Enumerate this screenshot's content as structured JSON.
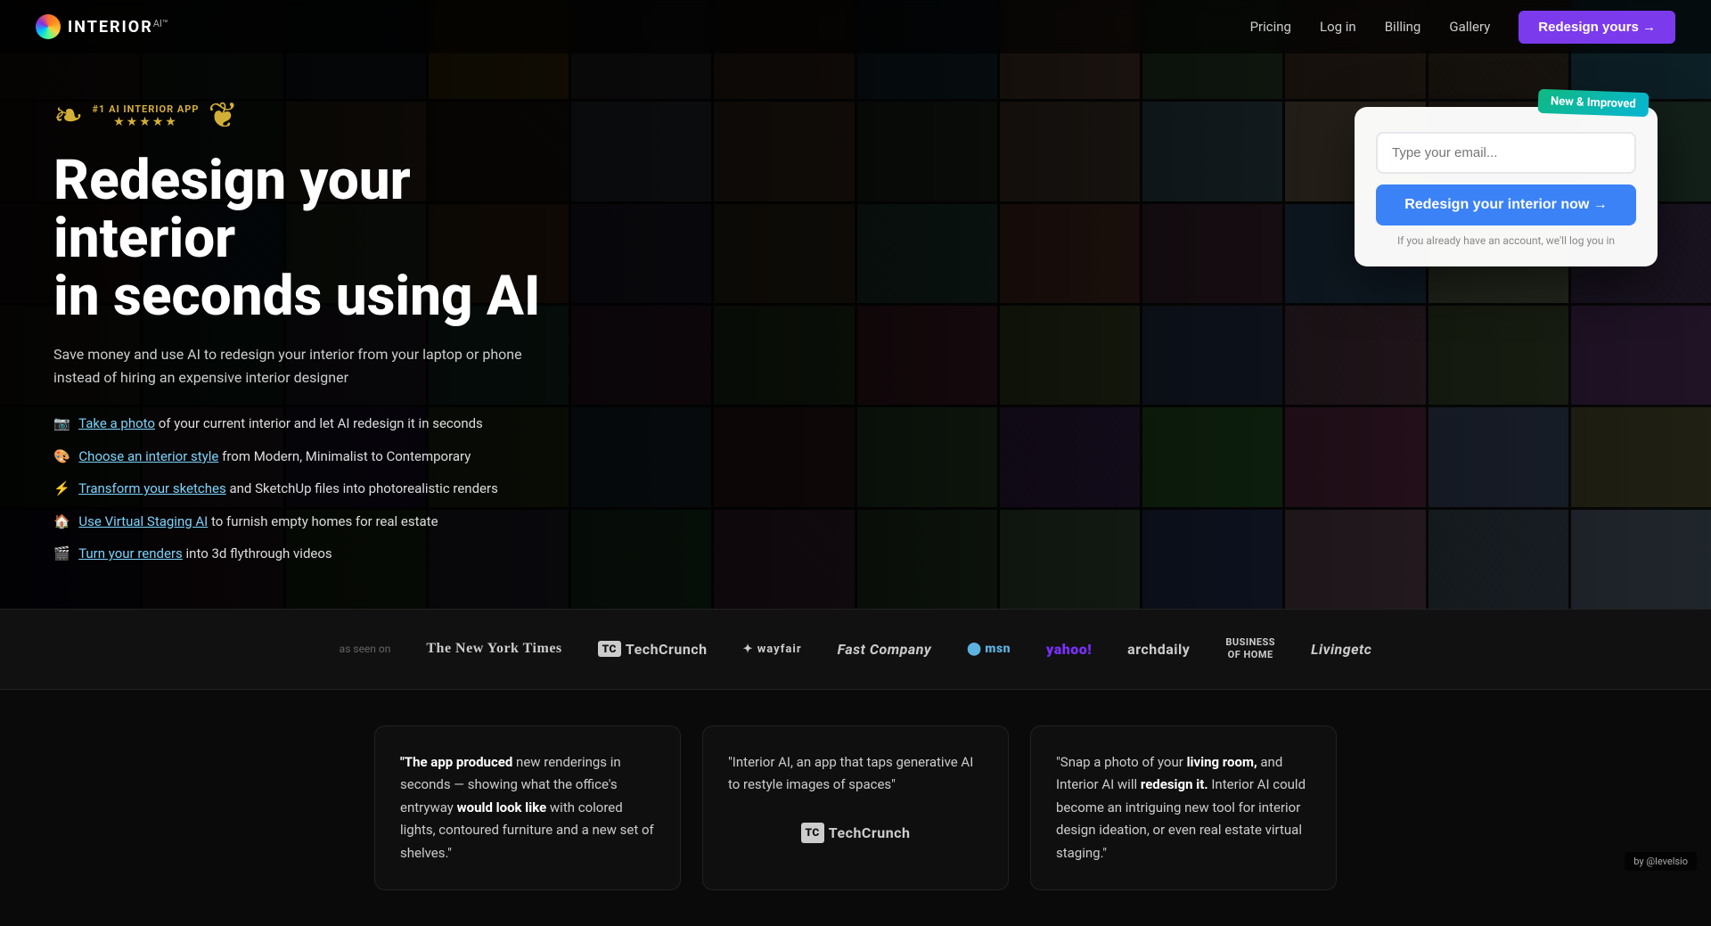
{
  "nav": {
    "logo_text": "INTERIOR",
    "logo_suffix": "AI™",
    "links": [
      {
        "id": "pricing",
        "label": "Pricing"
      },
      {
        "id": "login",
        "label": "Log in"
      },
      {
        "id": "billing",
        "label": "Billing"
      },
      {
        "id": "gallery",
        "label": "Gallery"
      }
    ],
    "cta_label": "Redesign yours →"
  },
  "hero": {
    "award_line1": "#1 AI Interior App",
    "award_stars": "★★★★★",
    "headline_line1": "Redesign your interior",
    "headline_line2": "in seconds using AI",
    "subtext": "Save money and use AI to redesign your interior from your laptop or phone instead of hiring an expensive interior designer",
    "features": [
      {
        "emoji": "📷",
        "link_text": "Take a photo",
        "rest": " of your current interior and let AI redesign it in seconds"
      },
      {
        "emoji": "🎨",
        "link_text": "Choose an interior style",
        "rest": " from Modern, Minimalist to Contemporary"
      },
      {
        "emoji": "⚡",
        "link_text": "Transform your sketches",
        "rest": " and SketchUp files into photorealistic renders"
      },
      {
        "emoji": "🏠",
        "link_text": "Use Virtual Staging AI",
        "rest": " to furnish empty homes for real estate"
      },
      {
        "emoji": "🎬",
        "link_text": "Turn your renders",
        "rest": " into 3d flythrough videos"
      }
    ],
    "new_badge": "New & Improved",
    "card": {
      "email_placeholder": "Type your email...",
      "cta_button": "Redesign your interior now →",
      "login_hint": "If you already have an account, we'll log you in"
    },
    "center_overlay_text": "Redesign your interior now"
  },
  "press": {
    "label": "as seen on",
    "logos": [
      {
        "id": "nyt",
        "text": "The New York Times"
      },
      {
        "id": "tc",
        "prefix": "TC",
        "text": "TechCrunch"
      },
      {
        "id": "wayfair",
        "text": "wayfair"
      },
      {
        "id": "fast",
        "text": "Fast Company"
      },
      {
        "id": "msn",
        "text": "msn"
      },
      {
        "id": "yahoo",
        "text": "yahoo!"
      },
      {
        "id": "arch",
        "text": "archdaily"
      },
      {
        "id": "boh",
        "text": "BUSINESS\nOF HOME"
      },
      {
        "id": "living",
        "text": "Livingetc"
      }
    ]
  },
  "testimonials": [
    {
      "id": "t1",
      "quote": "\"The app produced new renderings in seconds — showing what the office's entryway would look like with colored lights, contoured furniture and a new set of shelves.\"",
      "source_type": "text",
      "source": ""
    },
    {
      "id": "t2",
      "quote": "\"Interior AI, an app that taps generative AI to restyle images of spaces\"",
      "source_type": "logo",
      "source": "TechCrunch"
    },
    {
      "id": "t3",
      "quote": "\"Snap a photo of your living room, and Interior AI will redesign it. Interior AI could become an intriguing new tool for interior design ideation, or even real estate virtual staging.\"",
      "source_type": "text",
      "source": ""
    }
  ],
  "footer": {
    "credit": "by @levelsio"
  }
}
